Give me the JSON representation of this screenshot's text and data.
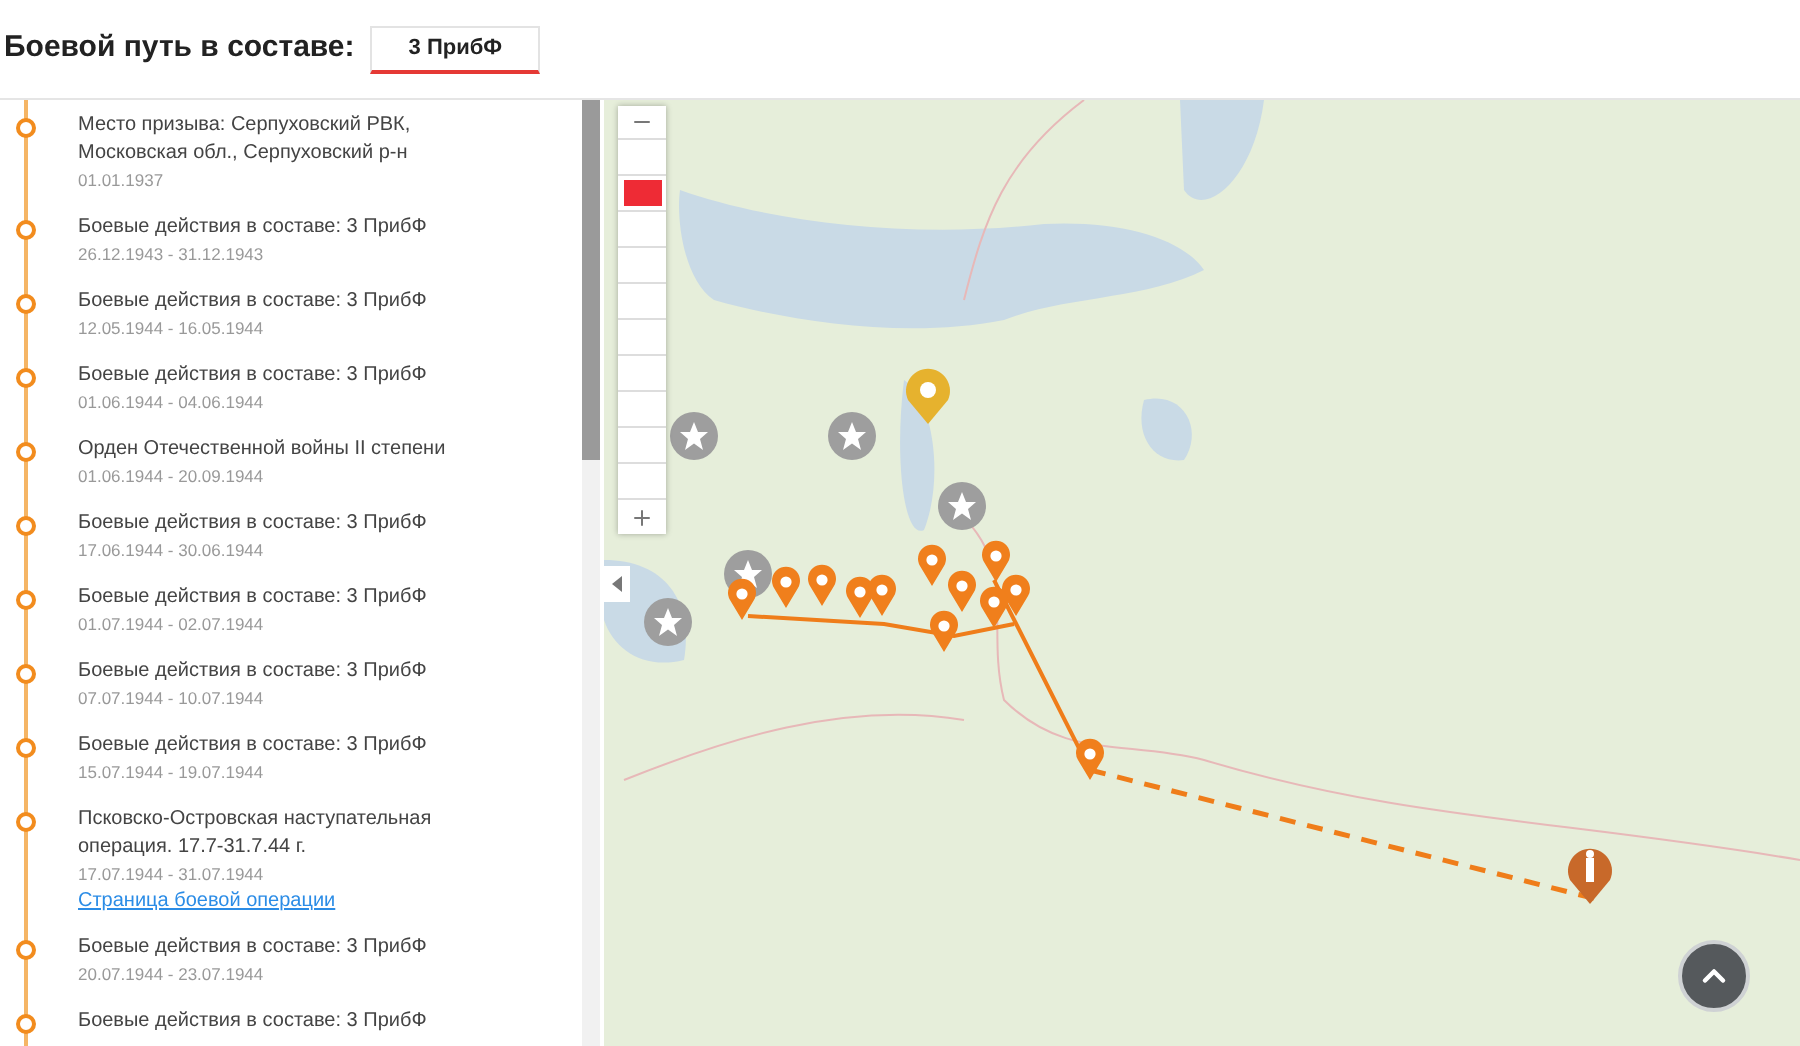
{
  "header": {
    "title": "Боевой путь в составе:",
    "tabs": [
      {
        "label": "3 ПрибФ",
        "selected": true
      }
    ]
  },
  "timeline": [
    {
      "title": "Место призыва: Серпуховский РВК, Московская обл., Серпуховский р-н",
      "date": "01.01.1937"
    },
    {
      "title": "Боевые действия в составе: 3 ПрибФ",
      "date": "26.12.1943 - 31.12.1943"
    },
    {
      "title": "Боевые действия в составе: 3 ПрибФ",
      "date": "12.05.1944 - 16.05.1944"
    },
    {
      "title": "Боевые действия в составе: 3 ПрибФ",
      "date": "01.06.1944 - 04.06.1944"
    },
    {
      "title": "Орден Отечественной войны II степени",
      "date": "01.06.1944 - 20.09.1944"
    },
    {
      "title": "Боевые действия в составе: 3 ПрибФ",
      "date": "17.06.1944 - 30.06.1944"
    },
    {
      "title": "Боевые действия в составе: 3 ПрибФ",
      "date": "01.07.1944 - 02.07.1944"
    },
    {
      "title": "Боевые действия в составе: 3 ПрибФ",
      "date": "07.07.1944 - 10.07.1944"
    },
    {
      "title": "Боевые действия в составе: 3 ПрибФ",
      "date": "15.07.1944 - 19.07.1944"
    },
    {
      "title": "Псковско-Островская наступательная операция. 17.7-31.7.44 г.",
      "date": "17.07.1944 - 31.07.1944",
      "link": "Страница боевой операции"
    },
    {
      "title": "Боевые действия в составе: 3 ПрибФ",
      "date": "20.07.1944 - 23.07.1944"
    },
    {
      "title": "Боевые действия в составе: 3 ПрибФ"
    }
  ],
  "map": {
    "zoom_steps": [
      {
        "selected": false
      },
      {
        "selected": true
      },
      {
        "selected": false
      },
      {
        "selected": false
      },
      {
        "selected": false
      },
      {
        "selected": false
      },
      {
        "selected": false
      },
      {
        "selected": false
      },
      {
        "selected": false
      },
      {
        "selected": false
      }
    ]
  }
}
